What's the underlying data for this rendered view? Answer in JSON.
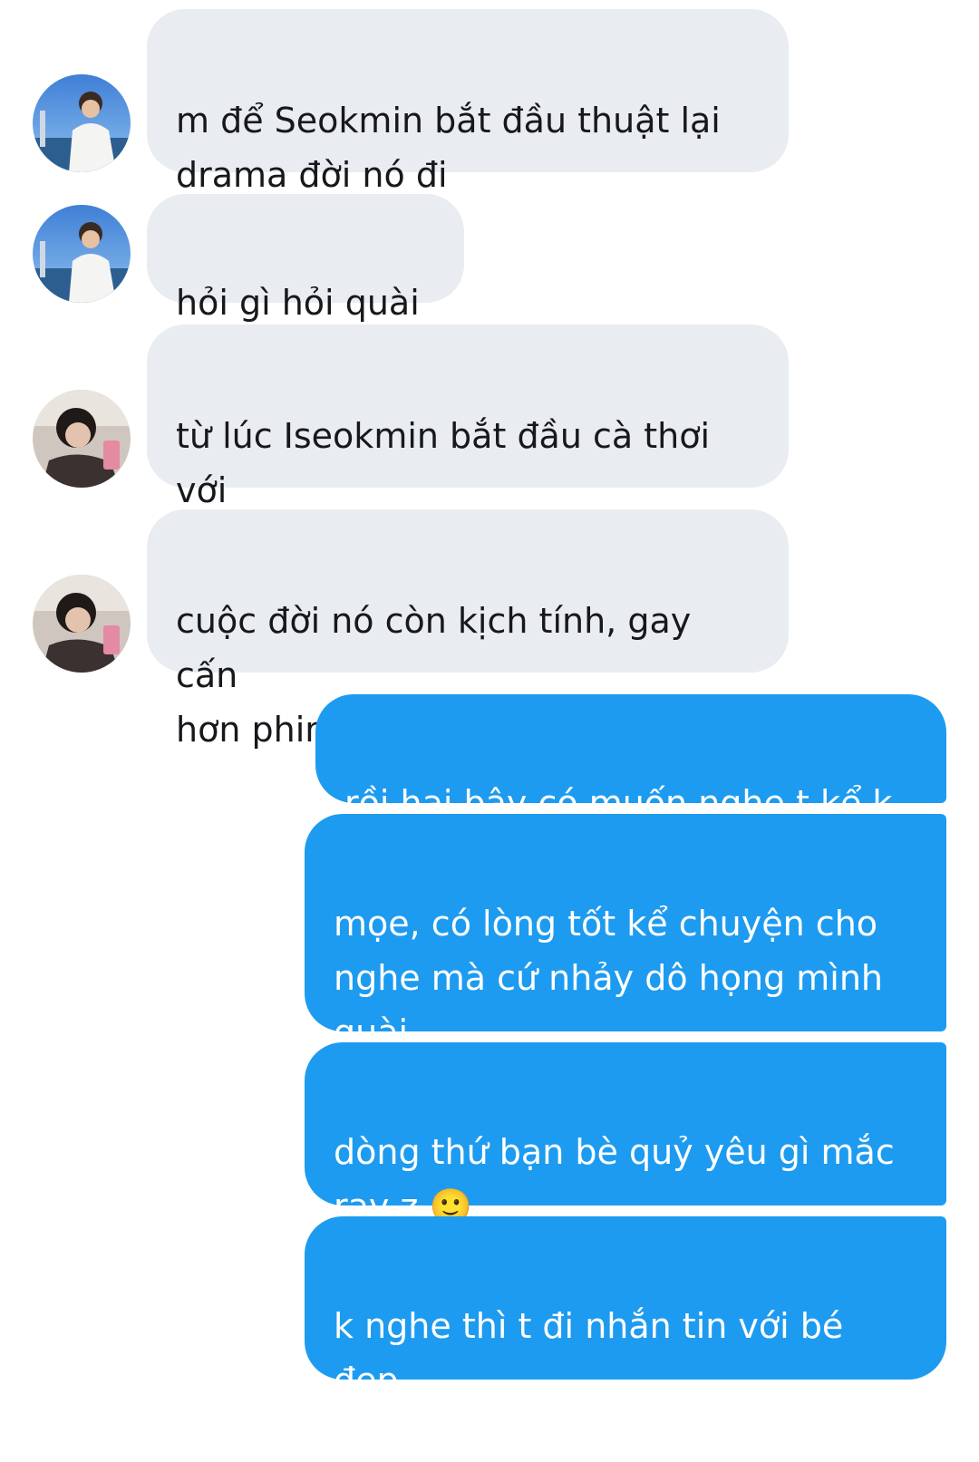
{
  "conversation": {
    "messages": [
      {
        "sender": "other",
        "avatar": "avatar-sea-photo",
        "text": "m để Seokmin bắt đầu thuật lại\ndrama đời nó đi"
      },
      {
        "sender": "other",
        "avatar": "avatar-sea-photo",
        "text": "hỏi gì hỏi quài z"
      },
      {
        "sender": "other",
        "avatar": "avatar-mirror-selfie",
        "text": "từ lúc Iseokmin bắt đầu cà thơi với\nHong Meo Meo"
      },
      {
        "sender": "other",
        "avatar": "avatar-mirror-selfie",
        "text": "cuộc đời nó còn kịch tính, gay cấn\nhơn phim hành động nữa"
      },
      {
        "sender": "self",
        "text": "rồi hai bây có muốn nghe t kể k 🤡"
      },
      {
        "sender": "self",
        "text": "mọe, có lòng tốt kể chuyện cho\nnghe mà cứ nhảy dô họng mình\nquài"
      },
      {
        "sender": "self",
        "text": "dòng thứ bạn bè quỷ yêu gì mắc\nrạy z 🙂"
      },
      {
        "sender": "self",
        "text": "k nghe thì t đi nhắn tin với bé đẹp\nđấy"
      }
    ]
  },
  "colors": {
    "incoming_bubble": "#e9ecf0",
    "outgoing_bubble": "#1d9bf0",
    "incoming_text": "#16181b",
    "outgoing_text": "#ffffff"
  }
}
